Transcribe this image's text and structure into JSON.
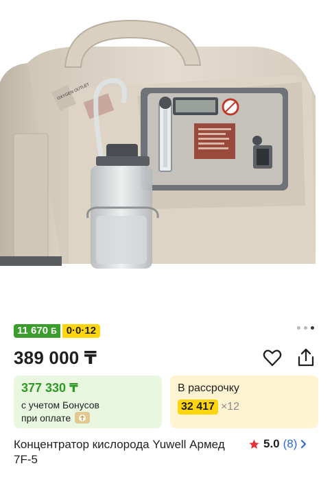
{
  "product_image": {
    "icon": "oxygen-concentrator-photo",
    "labels": [
      "OXYGEN OUTLET"
    ]
  },
  "badges": {
    "bonus_value": "11 670",
    "bonus_symbol": "Б",
    "installment": "0·0·12"
  },
  "gallery": {
    "pages": 3,
    "active_index": 2
  },
  "price": "389 000 ₸",
  "bonus_card": {
    "price": "377 330 ₸",
    "line1": "с учетом Бонусов",
    "line2": "при оплате",
    "icon": "coin-icon"
  },
  "installment_card": {
    "title": "В рассрочку",
    "amount": "32 417",
    "multiplier": "×12"
  },
  "product": {
    "title": "Концентратор кислорода Yuwell Армед 7F-5"
  },
  "rating": {
    "score": "5.0",
    "count": "(8)"
  },
  "colors": {
    "bonus_green": "#3a9d2c",
    "yellow": "#ffd60a",
    "link_blue": "#2f67d6",
    "star_red": "#e8303a"
  }
}
